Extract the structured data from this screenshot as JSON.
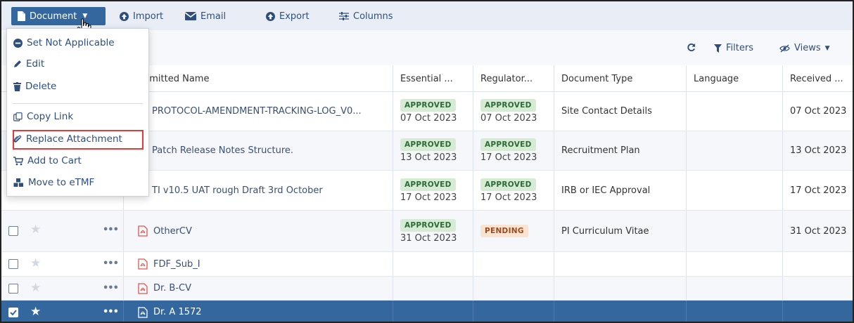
{
  "toolbar": {
    "document_label": "Document",
    "import_label": "Import",
    "email_label": "Email",
    "export_label": "Export",
    "columns_label": "Columns"
  },
  "subbar": {
    "filters_label": "Filters",
    "views_label": "Views"
  },
  "menu": {
    "items": [
      {
        "label": "Set Not Applicable",
        "icon": "minus-circle-icon"
      },
      {
        "label": "Edit",
        "icon": "pencil-icon"
      },
      {
        "label": "Delete",
        "icon": "trash-icon"
      },
      {
        "label": "Copy Link",
        "icon": "copy-link-icon"
      },
      {
        "label": "Replace Attachment",
        "icon": "paperclip-icon"
      },
      {
        "label": "Add to Cart",
        "icon": "cart-icon"
      },
      {
        "label": "Move to eTMF",
        "icon": "cubes-icon"
      }
    ],
    "highlighted": "Replace Attachment"
  },
  "table": {
    "columns": [
      "bmitted Name",
      "Essential ...",
      "Regulator...",
      "Document Type",
      "Language",
      "Received ..."
    ],
    "rows": [
      {
        "name": "PROTOCOL-AMENDMENT-TRACKING-LOG_V0...",
        "essential_status": "APPROVED",
        "essential_date": "07 Oct 2023",
        "regulatory_status": "APPROVED",
        "regulatory_date": "07 Oct 2023",
        "doc_type": "Site Contact Details",
        "language": "",
        "received": "07 Oct 2023"
      },
      {
        "name": "Patch Release Notes Structure.",
        "essential_status": "APPROVED",
        "essential_date": "13 Oct 2023",
        "regulatory_status": "APPROVED",
        "regulatory_date": "17 Oct 2023",
        "doc_type": "Recruitment Plan",
        "language": "",
        "received": "13 Oct 2023"
      },
      {
        "name": "TI v10.5 UAT rough Draft 3rd October",
        "essential_status": "APPROVED",
        "essential_date": "17 Oct 2023",
        "regulatory_status": "APPROVED",
        "regulatory_date": "17 Oct 2023",
        "doc_type": "IRB or IEC Approval",
        "language": "",
        "received": "17 Oct 2023"
      },
      {
        "name": "OtherCV",
        "essential_status": "APPROVED",
        "essential_date": "31 Oct 2023",
        "regulatory_status": "PENDING",
        "regulatory_date": "",
        "doc_type": "PI Curriculum Vitae",
        "language": "",
        "received": "31 Oct 2023"
      },
      {
        "name": "FDF_Sub_I",
        "essential_status": "",
        "essential_date": "",
        "regulatory_status": "",
        "regulatory_date": "",
        "doc_type": "",
        "language": "",
        "received": ""
      },
      {
        "name": "Dr. B-CV",
        "essential_status": "",
        "essential_date": "",
        "regulatory_status": "",
        "regulatory_date": "",
        "doc_type": "",
        "language": "",
        "received": ""
      },
      {
        "name": "Dr. A 1572",
        "essential_status": "",
        "essential_date": "",
        "regulatory_status": "",
        "regulatory_date": "",
        "doc_type": "",
        "language": "",
        "received": "",
        "selected": true
      }
    ]
  },
  "colors": {
    "accent": "#33679e",
    "approved_bg": "#d5ebd4",
    "pending_bg": "#fbe3d2",
    "highlight_border": "#e23b3b",
    "pdf_icon": "#e0574f"
  }
}
